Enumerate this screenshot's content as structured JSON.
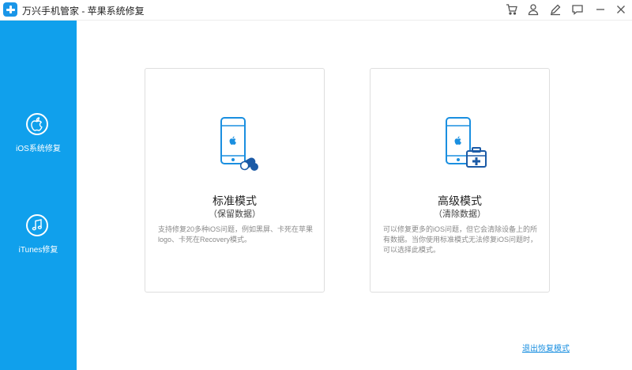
{
  "window": {
    "title": "万兴手机管家 - 苹果系统修复"
  },
  "titlebar_icons": [
    "cart-icon",
    "user-icon",
    "edit-icon",
    "feedback-icon",
    "minimize-icon",
    "close-icon"
  ],
  "sidebar": {
    "items": [
      {
        "label": "iOS系统修复",
        "icon": "apple-icon"
      },
      {
        "label": "iTunes修复",
        "icon": "music-note-icon"
      }
    ]
  },
  "cards": {
    "standard": {
      "title": "标准模式",
      "subtitle": "（保留数据）",
      "description": "支持修复20多种iOS问题，例如黑屏、卡死在苹果logo、卡死在Recovery模式。",
      "icon": "phone-pill-icon"
    },
    "advanced": {
      "title": "高级模式",
      "subtitle": "（清除数据）",
      "description": "可以修复更多的iOS问题，但它会清除设备上的所有数据。当你使用标准模式无法修复iOS问题时，可以选择此模式。",
      "icon": "phone-medkit-icon"
    }
  },
  "footer": {
    "exit_link": "退出恢复模式"
  },
  "colors": {
    "accent": "#1a96e8",
    "sidebar": "#10a0ec",
    "icon_blue": "#1a8fe0",
    "icon_dark": "#1b5aa6"
  }
}
